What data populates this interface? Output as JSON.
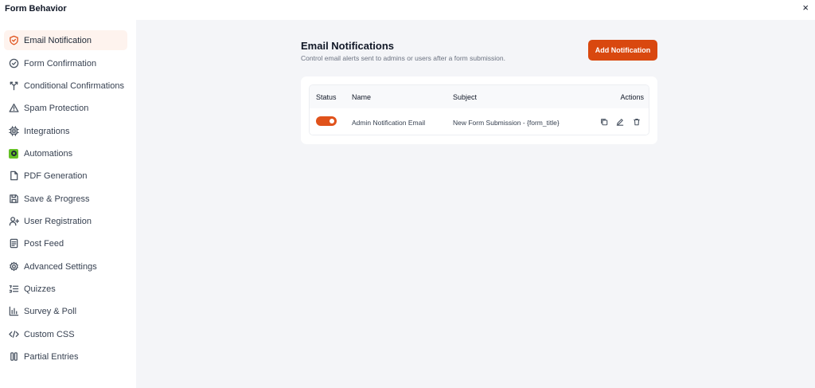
{
  "window": {
    "title": "Form Behavior",
    "close_label": "×"
  },
  "sidebar": {
    "items": [
      {
        "label": "Email Notification",
        "icon": "shield-icon",
        "active": true
      },
      {
        "label": "Form Confirmation",
        "icon": "check-circle-icon"
      },
      {
        "label": "Conditional Confirmations",
        "icon": "split-icon"
      },
      {
        "label": "Spam Protection",
        "icon": "warning-icon"
      },
      {
        "label": "Integrations",
        "icon": "chip-icon"
      },
      {
        "label": "Automations",
        "icon": "automation-icon"
      },
      {
        "label": "PDF Generation",
        "icon": "file-icon"
      },
      {
        "label": "Save & Progress",
        "icon": "save-icon"
      },
      {
        "label": "User Registration",
        "icon": "user-plus-icon"
      },
      {
        "label": "Post Feed",
        "icon": "document-icon"
      },
      {
        "label": "Advanced Settings",
        "icon": "gear-icon"
      },
      {
        "label": "Quizzes",
        "icon": "list-icon"
      },
      {
        "label": "Survey & Poll",
        "icon": "bar-chart-icon"
      },
      {
        "label": "Custom CSS",
        "icon": "code-icon"
      },
      {
        "label": "Partial Entries",
        "icon": "columns-icon"
      }
    ]
  },
  "main": {
    "title": "Email Notifications",
    "subtitle": "Control email alerts sent to admins or users after a form submission.",
    "add_button_label": "Add Notification",
    "table": {
      "headers": {
        "status": "Status",
        "name": "Name",
        "subject": "Subject",
        "actions": "Actions"
      },
      "rows": [
        {
          "enabled": true,
          "name": "Admin Notification Email",
          "subject": "New Form Submission - {form_title}",
          "actions": [
            "copy-icon",
            "edit-icon",
            "trash-icon"
          ]
        }
      ]
    }
  },
  "colors": {
    "accent": "#d9480f",
    "active_bg": "#fef3ee",
    "content_bg": "#f4f5f8",
    "automations_badge": "#65c126"
  }
}
